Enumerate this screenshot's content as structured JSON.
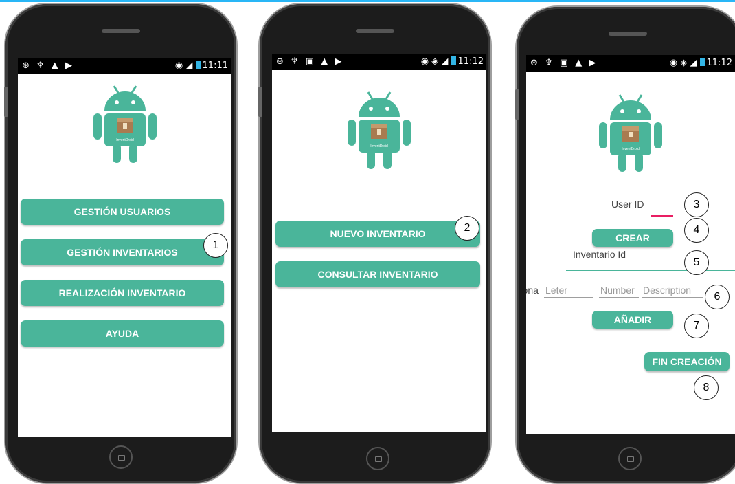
{
  "colors": {
    "accent": "#4ab59a",
    "button_text": "#ffffff",
    "field_focus_red": "#e91e63",
    "field_focus_green": "#4ab59a"
  },
  "status_bar": {
    "left_icons": [
      "wifi-icon",
      "usb-icon",
      "android-icon",
      "play-icon"
    ],
    "left_icons_ext": [
      "wifi-icon",
      "usb-icon",
      "image-icon",
      "android-icon",
      "play-icon"
    ],
    "time_1": "11:11",
    "time_2": "11:12",
    "time_3": "11:12"
  },
  "logo": {
    "icon": "android-box-icon",
    "caption": "InventDroid"
  },
  "screen1": {
    "buttons": [
      "GESTIÓN USUARIOS",
      "GESTIÓN INVENTARIOS",
      "REALIZACIÓN INVENTARIO",
      "AYUDA"
    ]
  },
  "screen2": {
    "buttons": [
      "NUEVO INVENTARIO",
      "CONSULTAR INVENTARIO"
    ]
  },
  "screen3": {
    "user_id_label": "User ID",
    "crear": "CREAR",
    "inventario_id_label": "Inventario Id",
    "zona_label": "Zona",
    "leter_hint": "Leter",
    "number_hint": "Number",
    "description_hint": "Description",
    "anadir": "AÑADIR",
    "fin_creacion": "FIN CREACIÓN"
  },
  "callouts": [
    "1",
    "2",
    "3",
    "4",
    "5",
    "6",
    "7",
    "8"
  ]
}
